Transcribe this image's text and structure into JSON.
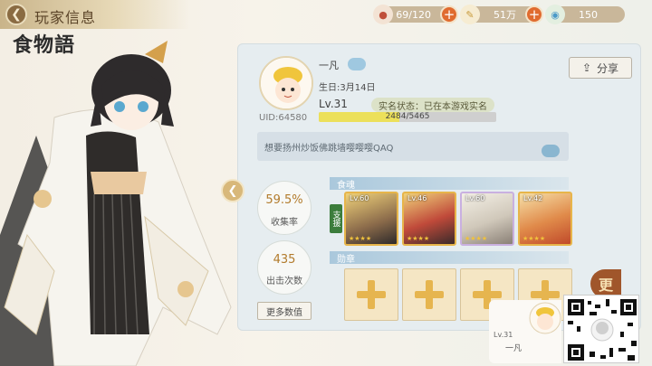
{
  "header": {
    "title": "玩家信息",
    "logo": "食物語"
  },
  "resources": [
    {
      "name": "stamina",
      "value": "69/120",
      "icon": "stamina-icon"
    },
    {
      "name": "coins",
      "value": "51万",
      "icon": "coin-icon"
    },
    {
      "name": "gems",
      "value": "150",
      "icon": "gem-icon"
    }
  ],
  "profile": {
    "name": "一凡",
    "birthday": "生日:3月14日",
    "level": "Lv.31",
    "realname_status": "实名状态：已在本游戏实名",
    "uid": "UID:64580",
    "xp": "2484/5465",
    "xp_fraction": 0.4545,
    "signature": "想要扬州炒饭佛跳墙嘤嘤嘤QAQ"
  },
  "share_label": "分享",
  "stats": [
    {
      "value": "59.5%",
      "label": "收集率"
    },
    {
      "value": "435",
      "label": "出击次数"
    }
  ],
  "more_stats_label": "更多数值",
  "characters_section": {
    "title": "食魂",
    "support_tag": "支援",
    "cards": [
      {
        "level": "Lv.60"
      },
      {
        "level": "Lv.46"
      },
      {
        "level": "Lv.60"
      },
      {
        "level": "Lv.42"
      }
    ]
  },
  "badges_section": {
    "title": "勋章",
    "slots": 4
  },
  "mini_card": {
    "level": "Lv.31",
    "name": "一凡"
  },
  "more_tab_label": "更"
}
